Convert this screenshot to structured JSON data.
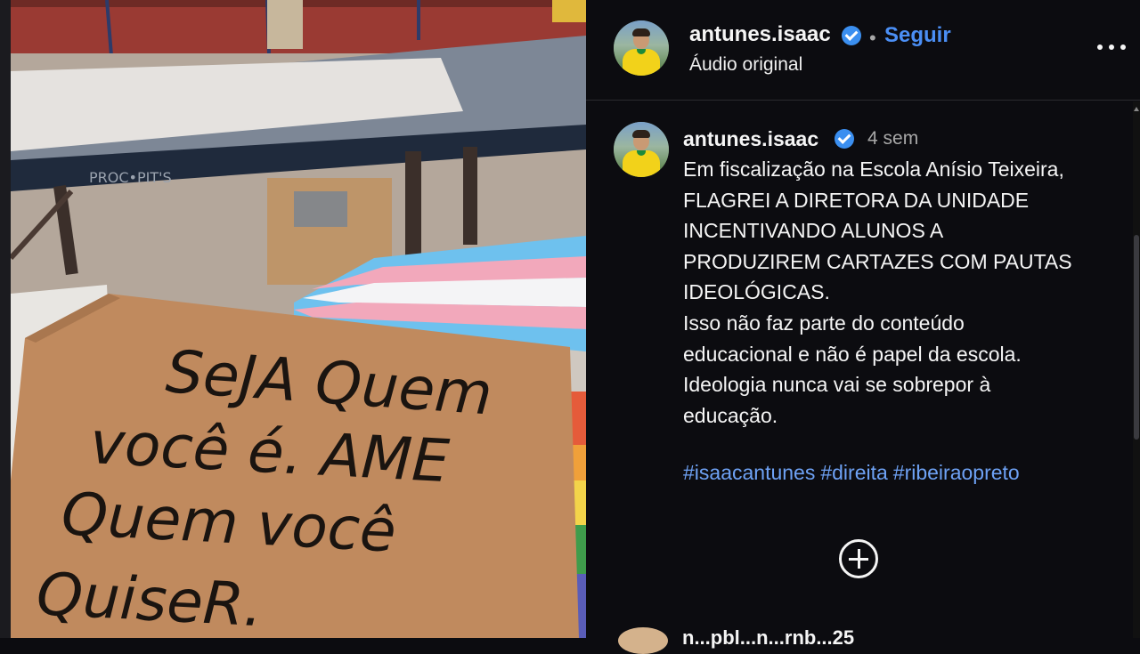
{
  "post": {
    "sign_text": [
      "SeJA Quem",
      "você é. AME",
      "Quem você",
      "QuiseR."
    ]
  },
  "header": {
    "username": "antunes.isaac",
    "separator": "•",
    "follow_label": "Seguir",
    "audio_label": "Áudio original"
  },
  "caption": {
    "username": "antunes.isaac",
    "time": "4 sem",
    "text": "Em fiscalização na Escola Anísio Teixeira,\nFLAGREI A DIRETORA DA UNIDADE\nINCENTIVANDO ALUNOS A\nPRODUZIREM CARTAZES COM PAUTAS\nIDEOLÓGICAS.\nIsso não faz parte do conteúdo\neducacional e não é papel da escola.\nIdeologia nunca vai se sobrepor à\neducação.",
    "hashtags": [
      "#isaacantunes",
      "#direita",
      "#ribeiraopreto"
    ]
  },
  "next_comment": {
    "username": "n...pbl...n...rnb...25"
  },
  "colors": {
    "background": "#0c0c10",
    "accent": "#4b8ff5",
    "hashtag": "#6ea2f5",
    "verified": "#3b8ff0"
  },
  "icons": [
    "verified-badge-icon",
    "more-options-icon",
    "add-comment-icon"
  ]
}
